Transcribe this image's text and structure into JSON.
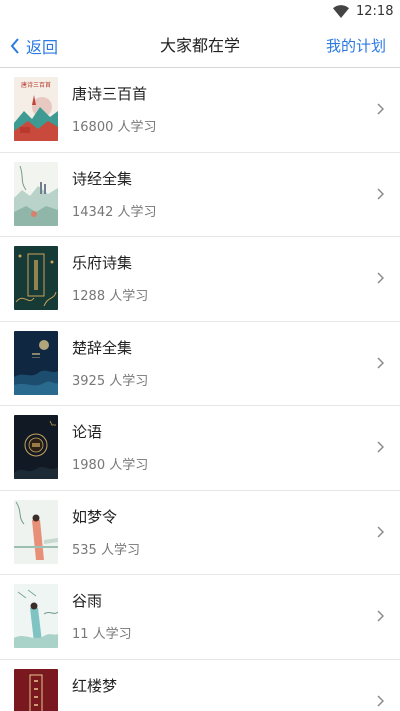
{
  "status_bar": {
    "time": "12:18"
  },
  "nav": {
    "back_label": "返回",
    "title": "大家都在学",
    "right_label": "我的计划"
  },
  "books": [
    {
      "title": "唐诗三百首",
      "learners": "16800 人学习",
      "cover_icon": "tang-poems-cover",
      "cover_text": "唐诗三百首"
    },
    {
      "title": "诗经全集",
      "learners": "14342 人学习",
      "cover_icon": "shijing-cover",
      "cover_text": ""
    },
    {
      "title": "乐府诗集",
      "learners": "1288 人学习",
      "cover_icon": "yuefu-cover",
      "cover_text": ""
    },
    {
      "title": "楚辞全集",
      "learners": "3925 人学习",
      "cover_icon": "chuci-cover",
      "cover_text": ""
    },
    {
      "title": "论语",
      "learners": "1980 人学习",
      "cover_icon": "lunyu-cover",
      "cover_text": ""
    },
    {
      "title": "如梦令",
      "learners": "535 人学习",
      "cover_icon": "rumengling-cover",
      "cover_text": ""
    },
    {
      "title": "谷雨",
      "learners": "11 人学习",
      "cover_icon": "guyu-cover",
      "cover_text": ""
    },
    {
      "title": "红楼梦",
      "learners": "",
      "cover_icon": "hongloumeng-cover",
      "cover_text": ""
    }
  ],
  "colors": {
    "accent": "#2a7ae2",
    "divider": "#e6e6e6"
  }
}
